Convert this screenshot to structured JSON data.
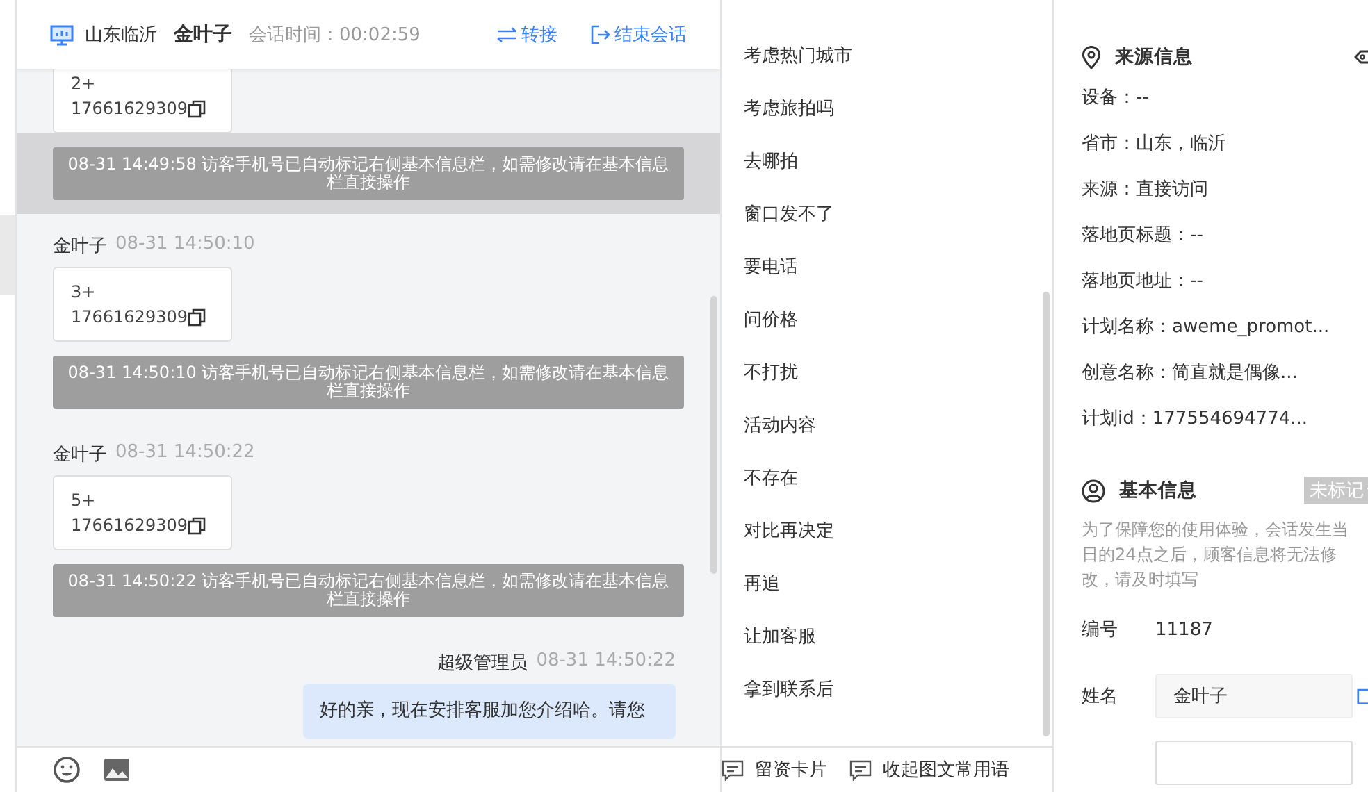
{
  "header": {
    "region": "山东临沂",
    "name": "金叶子",
    "session_time": "会话时间：00:02:59",
    "transfer": "转接",
    "end": "结束会话"
  },
  "messages": [
    {
      "kind": "card",
      "lines": [
        "2+",
        "17661629309"
      ]
    },
    {
      "kind": "notice",
      "highlighted": true,
      "text": "08-31 14:49:58 访客手机号已自动标记右侧基本信息栏，如需修改请在基本信息栏直接操作"
    },
    {
      "kind": "card",
      "sender": "金叶子",
      "time": "08-31 14:50:10",
      "lines": [
        "3+",
        "17661629309"
      ]
    },
    {
      "kind": "notice",
      "highlighted": false,
      "text": "08-31 14:50:10 访客手机号已自动标记右侧基本信息栏，如需修改请在基本信息栏直接操作"
    },
    {
      "kind": "card",
      "sender": "金叶子",
      "time": "08-31 14:50:22",
      "lines": [
        "5+",
        "17661629309"
      ]
    },
    {
      "kind": "notice",
      "highlighted": false,
      "text": "08-31 14:50:22 访客手机号已自动标记右侧基本信息栏，如需修改请在基本信息栏直接操作"
    },
    {
      "kind": "outgoing",
      "sender": "超级管理员",
      "time": "08-31 14:50:22",
      "text": "好的亲，现在安排客服加您介绍哈。请您"
    }
  ],
  "phrases": [
    "考虑热门城市",
    "考虑旅拍吗",
    "去哪拍",
    "窗口发不了",
    "要电话",
    "问价格",
    "不打扰",
    "活动内容",
    "不存在",
    "对比再决定",
    "再追",
    "让加客服",
    "拿到联系后"
  ],
  "footer": {
    "card_button": "留资卡片",
    "collapse_button": "收起图文常用语"
  },
  "source_info": {
    "title": "来源信息",
    "fields": [
      "设备：--",
      "省市：山东，临沂",
      "来源：直接访问",
      "落地页标题：--",
      "落地页地址：--",
      "计划名称：aweme_promot...",
      "创意名称：简直就是偶像...",
      "计划id：177554694774..."
    ]
  },
  "basic_info": {
    "title": "基本信息",
    "tag": "未标记",
    "note": "为了保障您的使用体验，会话发生当日的24点之后，顾客信息将无法修改，请及时填写",
    "fields": [
      {
        "kind": "text",
        "label": "编号",
        "value": "11187"
      },
      {
        "kind": "input",
        "label": "姓名",
        "value": "金叶子"
      },
      {
        "kind": "input"
      }
    ]
  }
}
